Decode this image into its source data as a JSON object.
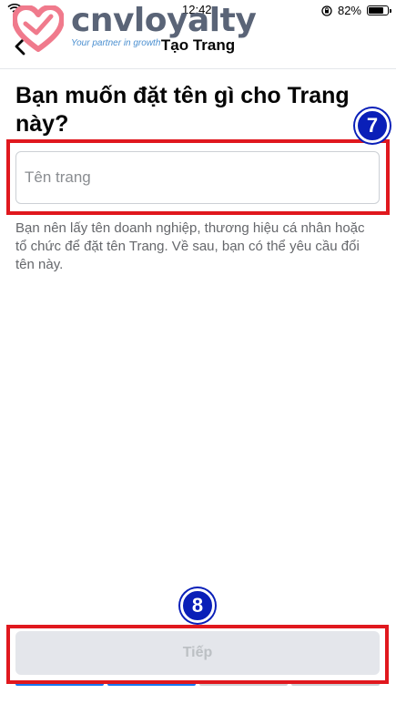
{
  "status_bar": {
    "time": "12:42",
    "battery_percent": "82%",
    "battery_level": 0.82
  },
  "watermark": {
    "brand": "cnvloyalty",
    "tagline": "Your partner in growth",
    "heart_color": "#f07a8c"
  },
  "nav": {
    "title": "Tạo Trang",
    "back_icon": "chevron-left-icon"
  },
  "main": {
    "heading": "Bạn muốn đặt tên gì cho Trang này?",
    "name_input": {
      "placeholder": "Tên trang",
      "value": ""
    },
    "hint": "Bạn nên lấy tên doanh nghiệp, thương hiệu cá nhân hoặc tổ chức để đặt tên Trang. Về sau, bạn có thể yêu cầu đổi tên này."
  },
  "footer": {
    "next_label": "Tiếp",
    "progress": {
      "completed_steps": 2,
      "total_steps": 4,
      "active_color": "#1877f2",
      "inactive_color": "#ccd0d5"
    }
  },
  "annotations": {
    "step_input": "7",
    "step_next": "8",
    "box_color": "#e0181e",
    "badge_color": "#0a1fb8"
  }
}
